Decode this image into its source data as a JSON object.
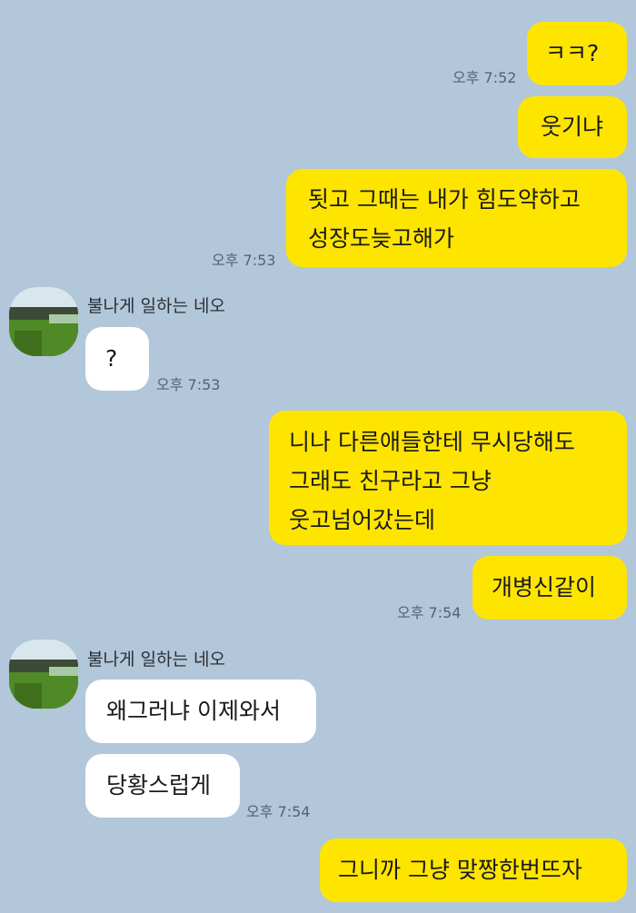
{
  "messages": [
    {
      "sender": "me",
      "lines": [
        "ㅋㅋ?"
      ],
      "time": "오후 7:52"
    },
    {
      "sender": "me",
      "lines": [
        "웃기냐"
      ]
    },
    {
      "sender": "me",
      "lines": [
        "됫고 그때는 내가 힘도약하고",
        "성장도늦고해가"
      ],
      "time": "오후 7:53"
    },
    {
      "sender": "them",
      "lines": [
        "?"
      ],
      "time": "오후 7:53"
    },
    {
      "sender": "me",
      "lines": [
        "니나 다른애들한테 무시당해도",
        "그래도 친구라고 그냥",
        "웃고넘어갔는데"
      ]
    },
    {
      "sender": "me",
      "lines": [
        "개병신같이"
      ],
      "time": "오후 7:54"
    },
    {
      "sender": "them",
      "lines": [
        "왜그러냐 이제와서"
      ]
    },
    {
      "sender": "them",
      "lines": [
        "당황스럽게"
      ],
      "time": "오후 7:54"
    },
    {
      "sender": "me",
      "lines": [
        "그니까 그냥 맞짱한번뜨자"
      ]
    }
  ],
  "contacts": [
    {
      "name": "불나게 일하는 네오"
    },
    {
      "name": "불나게 일하는 네오"
    }
  ],
  "colors": {
    "background": "#b2c7da",
    "my_bubble": "#fee500",
    "their_bubble": "#ffffff"
  }
}
